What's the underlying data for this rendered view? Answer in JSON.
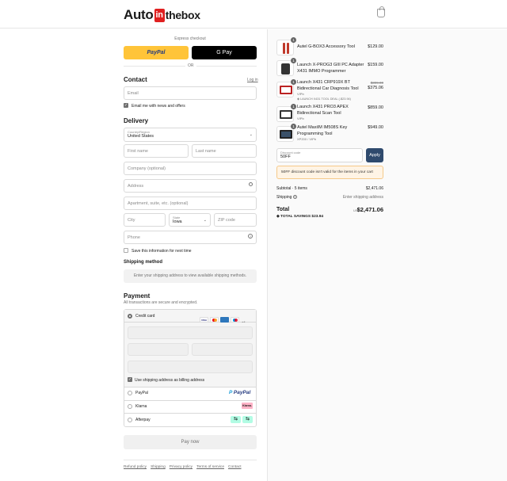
{
  "header": {
    "logo_left": "Auto",
    "logo_mid": "in",
    "logo_right": "thebox",
    "cart_icon": "shopping-bag-icon"
  },
  "express": {
    "label": "Express checkout",
    "paypal": "PayPal",
    "gpay": "G Pay",
    "or": "OR"
  },
  "contact": {
    "title": "Contact",
    "login": "Log in",
    "email_placeholder": "Email",
    "news_label": "Email me with news and offers"
  },
  "delivery": {
    "title": "Delivery",
    "country_label": "Country/Region",
    "country_value": "United States",
    "first_name": "First name",
    "last_name": "Last name",
    "company": "Company (optional)",
    "address": "Address",
    "apartment": "Apartment, suite, etc. (optional)",
    "city": "City",
    "state_label": "State",
    "state_value": "Iowa",
    "zip": "ZIP code",
    "phone": "Phone",
    "save_label": "Save this information for next time"
  },
  "shipping_method": {
    "title": "Shipping method",
    "notice": "Enter your shipping address to view available shipping methods."
  },
  "payment": {
    "title": "Payment",
    "subtitle": "All transactions are secure and encrypted.",
    "credit_card": "Credit card",
    "billing_label": "Use shipping address as billing address",
    "paypal": "PayPal",
    "klarna": "Klarna",
    "klarna_badge": "Klarna.",
    "afterpay": "Afterpay",
    "pay_now": "Pay now",
    "card_more": "+4"
  },
  "footer": {
    "links": [
      "Refund policy",
      "Shipping",
      "Privacy policy",
      "Terms of service",
      "Contact"
    ]
  },
  "cart": {
    "items": [
      {
        "qty": "1",
        "name": "Autel G-BOX3 Accessory Tool",
        "price": "$129.00",
        "note": "",
        "old_price": "",
        "discount": ""
      },
      {
        "qty": "1",
        "name": "Launch X-PROG3 GIII PC Adapter X431 IMMO Programmer",
        "price": "$159.00",
        "note": "",
        "old_price": "",
        "discount": ""
      },
      {
        "qty": "1",
        "name": "Launch X431 CRP919X BT Bidirectional Car Diagnosis Tool",
        "price": "$375.06",
        "note": "VIPb",
        "old_price": "$399.00",
        "discount": "LAUNCH X431 TOOL DEAL (-$23.94)"
      },
      {
        "qty": "1",
        "name": "Launch X431 PRO3 APEX Bidirectional Scan Tool",
        "price": "$859.00",
        "note": "VIPb",
        "old_price": "",
        "discount": ""
      },
      {
        "qty": "1",
        "name": "Autel MaxiIM IM508S Key Programming Tool",
        "price": "$949.00",
        "note": "XP200 / VIPb",
        "old_price": "",
        "discount": ""
      }
    ],
    "discount_label": "Discount code",
    "discount_value": "50FF",
    "apply": "Apply",
    "error": "50FF discount code isn't valid for the items in your cart",
    "subtotal_label": "Subtotal · 5 items",
    "subtotal_value": "$2,471.06",
    "shipping_label": "Shipping",
    "shipping_value": "Enter shipping address",
    "total_label": "Total",
    "currency": "USD",
    "total_value": "$2,471.06",
    "savings_label": "TOTAL SAVINGS",
    "savings_value": "$23.94"
  },
  "colors": {
    "paypal_yellow": "#ffc439",
    "gpay_black": "#000000",
    "apply_blue": "#2f4a6d",
    "error_bg": "#fff4e5",
    "error_border": "#f5c98a"
  }
}
